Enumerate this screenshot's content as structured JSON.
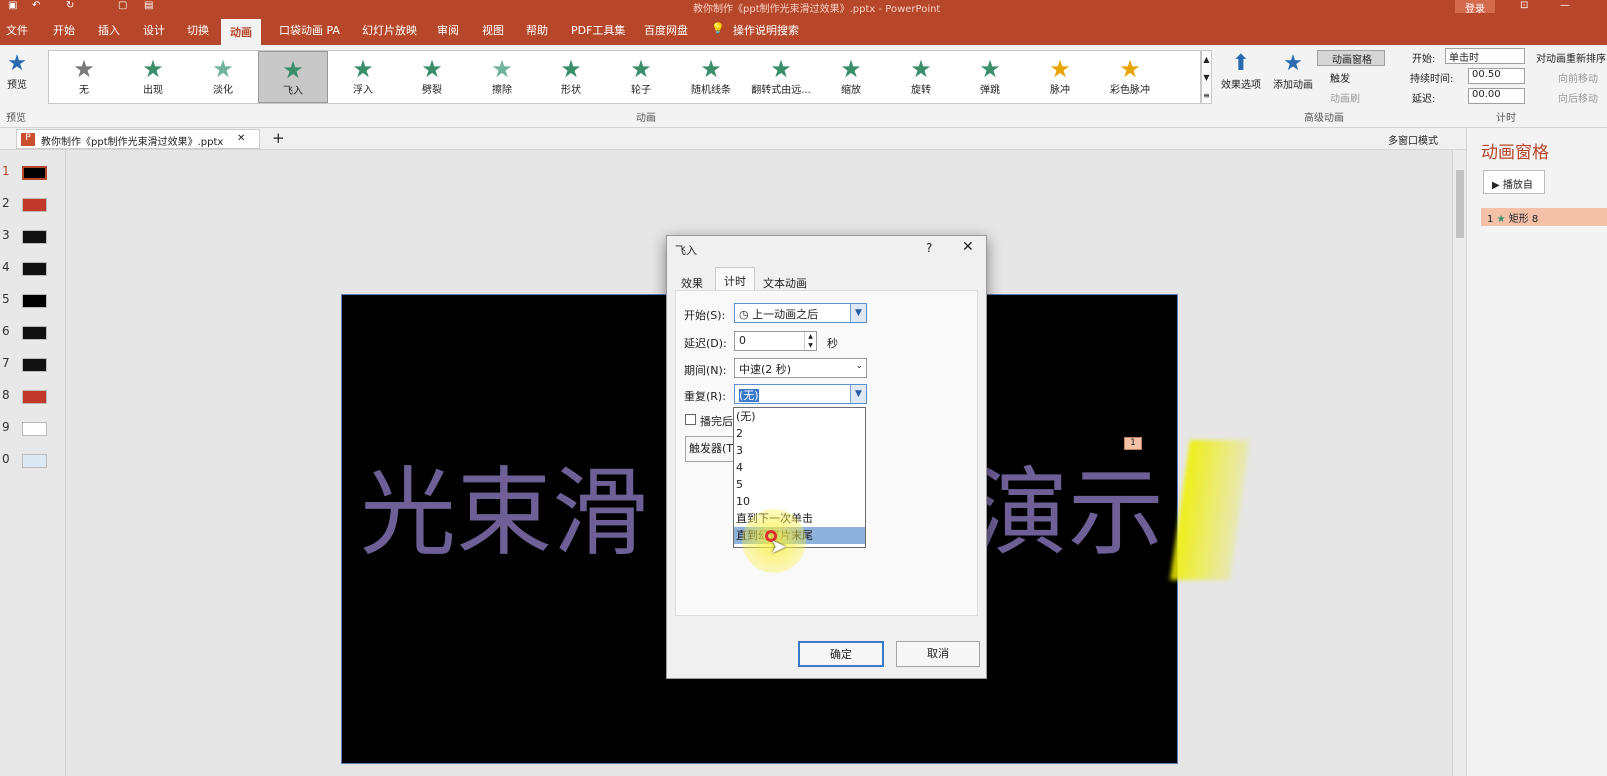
{
  "window": {
    "title": "教你制作《ppt制作光束滑过效果》.pptx  -  PowerPoint",
    "login": "登录"
  },
  "tabs": [
    "文件",
    "开始",
    "插入",
    "设计",
    "切换",
    "动画",
    "口袋动画 PA",
    "幻灯片放映",
    "审阅",
    "视图",
    "帮助",
    "PDF工具集",
    "百度网盘"
  ],
  "tell_me": "操作说明搜索",
  "ribbon": {
    "preview": "预览",
    "preview_group": "预览",
    "gallery": [
      {
        "label": "无",
        "color": "#7a7a7a"
      },
      {
        "label": "出现",
        "color": "#3a8f6a"
      },
      {
        "label": "淡化",
        "color": "#6fb39a"
      },
      {
        "label": "飞入",
        "color": "#3a8f6a"
      },
      {
        "label": "浮入",
        "color": "#3a8f6a"
      },
      {
        "label": "劈裂",
        "color": "#3a8f6a"
      },
      {
        "label": "擦除",
        "color": "#6fb39a"
      },
      {
        "label": "形状",
        "color": "#3a8f6a"
      },
      {
        "label": "轮子",
        "color": "#3a8f6a"
      },
      {
        "label": "随机线条",
        "color": "#3a8f6a"
      },
      {
        "label": "翻转式由远...",
        "color": "#3a8f6a"
      },
      {
        "label": "缩放",
        "color": "#3a8f6a"
      },
      {
        "label": "旋转",
        "color": "#3a8f6a"
      },
      {
        "label": "弹跳",
        "color": "#3a8f6a"
      },
      {
        "label": "脉冲",
        "color": "#e8a400"
      },
      {
        "label": "彩色脉冲",
        "color": "#e8a400"
      }
    ],
    "effect_options": "效果选项",
    "anim_group": "动画",
    "add_animation": "添加动画",
    "anim_pane_btn": "动画窗格",
    "trigger": "触发",
    "anim_painter": "动画刷",
    "adv_group": "高级动画",
    "start_label": "开始:",
    "start_value": "单击时",
    "duration_label": "持续时间:",
    "duration_value": "00.50",
    "delay_label": "延迟:",
    "delay_value": "00.00",
    "reorder": "对动画重新排序",
    "move_earlier": "向前移动",
    "move_later": "向后移动",
    "timing_group": "计时"
  },
  "doc_tab": "教你制作《ppt制作光束滑过效果》.pptx",
  "multiwindow": "多窗口模式",
  "thumbs": [
    {
      "n": "1",
      "color": "#000"
    },
    {
      "n": "2",
      "color": "#c0392b"
    },
    {
      "n": "3",
      "color": "#111"
    },
    {
      "n": "4",
      "color": "#111"
    },
    {
      "n": "5",
      "color": "#000"
    },
    {
      "n": "6",
      "color": "#111"
    },
    {
      "n": "7",
      "color": "#111"
    },
    {
      "n": "8",
      "color": "#c0392b"
    },
    {
      "n": "9",
      "color": "#fff"
    },
    {
      "n": "0",
      "color": "#dde8f5"
    }
  ],
  "slide": {
    "text_left": "光束滑",
    "text_right": "演示",
    "badge": "1"
  },
  "anim_pane": {
    "title": "动画窗格",
    "play": "播放自",
    "item_num": "1",
    "item_name": "矩形 8"
  },
  "dialog": {
    "title": "飞入",
    "help": "?",
    "tabs": [
      "效果",
      "计时",
      "文本动画"
    ],
    "start_label": "开始(S):",
    "start_value": "上一动画之后",
    "delay_label": "延迟(D):",
    "delay_value": "0",
    "delay_unit": "秒",
    "period_label": "期间(N):",
    "period_value": "中速(2 秒)",
    "repeat_label": "重复(R):",
    "repeat_value": "(无)",
    "rewind": "播完后快退",
    "trigger_btn": "触发器(T)",
    "ok": "确定",
    "cancel": "取消",
    "repeat_options": [
      "(无)",
      "2",
      "3",
      "4",
      "5",
      "10",
      "直到下一次单击",
      "直到幻灯片末尾"
    ]
  }
}
